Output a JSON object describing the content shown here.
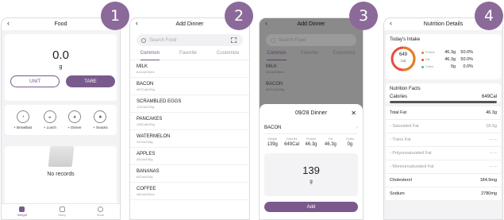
{
  "badges": [
    "1",
    "2",
    "3",
    "4"
  ],
  "screen1": {
    "title": "Food",
    "weight_value": "0.0",
    "weight_unit": "g",
    "unit_button": "UNIT",
    "tare_button": "TARE",
    "meals": [
      "+ Breakfast",
      "+ Lunch",
      "+ Dinner",
      "+ Snacks"
    ],
    "empty_text": "No records",
    "tabs": [
      "Weight",
      "Diary",
      "More"
    ]
  },
  "screen2": {
    "title": "Add Dinner",
    "search_placeholder": "Search Food",
    "tabs": [
      "Common",
      "Favorite",
      "Customize"
    ],
    "foods": [
      {
        "name": "MILK",
        "cal": "61Cal/100ml"
      },
      {
        "name": "BACON",
        "cal": "467Cal/100g"
      },
      {
        "name": "SCRAMBLED EGGS",
        "cal": "113Cal/100g"
      },
      {
        "name": "PANCAKES",
        "cal": "238Cal/100g"
      },
      {
        "name": "WATERMELON",
        "cal": "31Cal/100g"
      },
      {
        "name": "APPLES",
        "cal": "42Cal/100g"
      },
      {
        "name": "BANANAS",
        "cal": "62Cal/100g"
      },
      {
        "name": "COFFEE",
        "cal": "38Cal/100ml"
      }
    ]
  },
  "screen3": {
    "title": "Add Dinner",
    "search_placeholder": "Search Food",
    "tabs": [
      "Common",
      "Favorite",
      "Customize"
    ],
    "foods": [
      {
        "name": "MILK",
        "cal": "61Cal/100ml"
      },
      {
        "name": "BACON",
        "cal": "467Cal/100g"
      }
    ],
    "sheet_title": "09/28 Dinner",
    "food_name": "BACON",
    "nutrients": [
      {
        "label": "Weight",
        "value": "139g"
      },
      {
        "label": "Calories",
        "value": "649Cal"
      },
      {
        "label": "Protein",
        "value": "46.3g"
      },
      {
        "label": "Fat",
        "value": "46.3g"
      },
      {
        "label": "Carbs",
        "value": "0g"
      }
    ],
    "quantity": "139",
    "quantity_unit": "g",
    "add_button": "Add"
  },
  "screen4": {
    "title": "Nutrition Details",
    "intake_title": "Today's Intake",
    "ring_value": "649",
    "ring_unit": "Cal",
    "macros": [
      {
        "name": "Protein",
        "grams": "46.3g",
        "pct": "50.0%",
        "color": "#e67e22"
      },
      {
        "name": "Fat",
        "grams": "46.3g",
        "pct": "50.0%",
        "color": "#e74c3c"
      },
      {
        "name": "Carbs",
        "grams": "0g",
        "pct": "0.0%",
        "color": "#2ecc71"
      }
    ],
    "facts_title": "Nutrition Facts",
    "calories_label": "Calories",
    "calories_value": "649Cal",
    "facts": [
      {
        "label": "Total Fat",
        "value": "46.3g",
        "sub": false
      },
      {
        "label": "- Saturated Fat",
        "value": "18.5g",
        "sub": true
      },
      {
        "label": "- Trans Fat",
        "value": "-- --",
        "sub": true
      },
      {
        "label": "- Polyunsaturated Fat",
        "value": "-- --",
        "sub": true
      },
      {
        "label": "- Monounsaturated Fat",
        "value": "-- --",
        "sub": true
      },
      {
        "label": "Cholesterol",
        "value": "184.9mg",
        "sub": false
      },
      {
        "label": "Sodium",
        "value": "2780mg",
        "sub": false
      }
    ]
  },
  "colors": {
    "accent": "#7a5a8c",
    "badge": "#8b6a9a"
  }
}
